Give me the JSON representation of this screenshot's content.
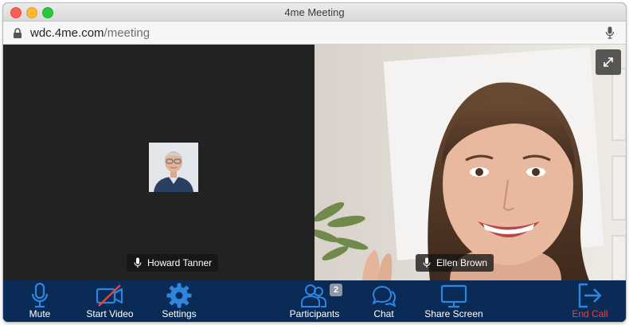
{
  "window": {
    "title": "4me Meeting"
  },
  "address": {
    "host": "wdc.4me.com",
    "path": "/meeting"
  },
  "participants_tiles": [
    {
      "name": "Howard Tanner",
      "video": "off"
    },
    {
      "name": "Ellen Brown",
      "video": "on"
    }
  ],
  "toolbar": {
    "mute_label": "Mute",
    "video_label": "Start Video",
    "settings_label": "Settings",
    "participants_label": "Participants",
    "participants_count": "2",
    "chat_label": "Chat",
    "share_label": "Share Screen",
    "end_label": "End Call"
  },
  "colors": {
    "toolbar_bg": "#0b2b57",
    "icon_blue": "#2f86e0",
    "end_red": "#e2463b",
    "left_tile_bg": "#222222"
  }
}
